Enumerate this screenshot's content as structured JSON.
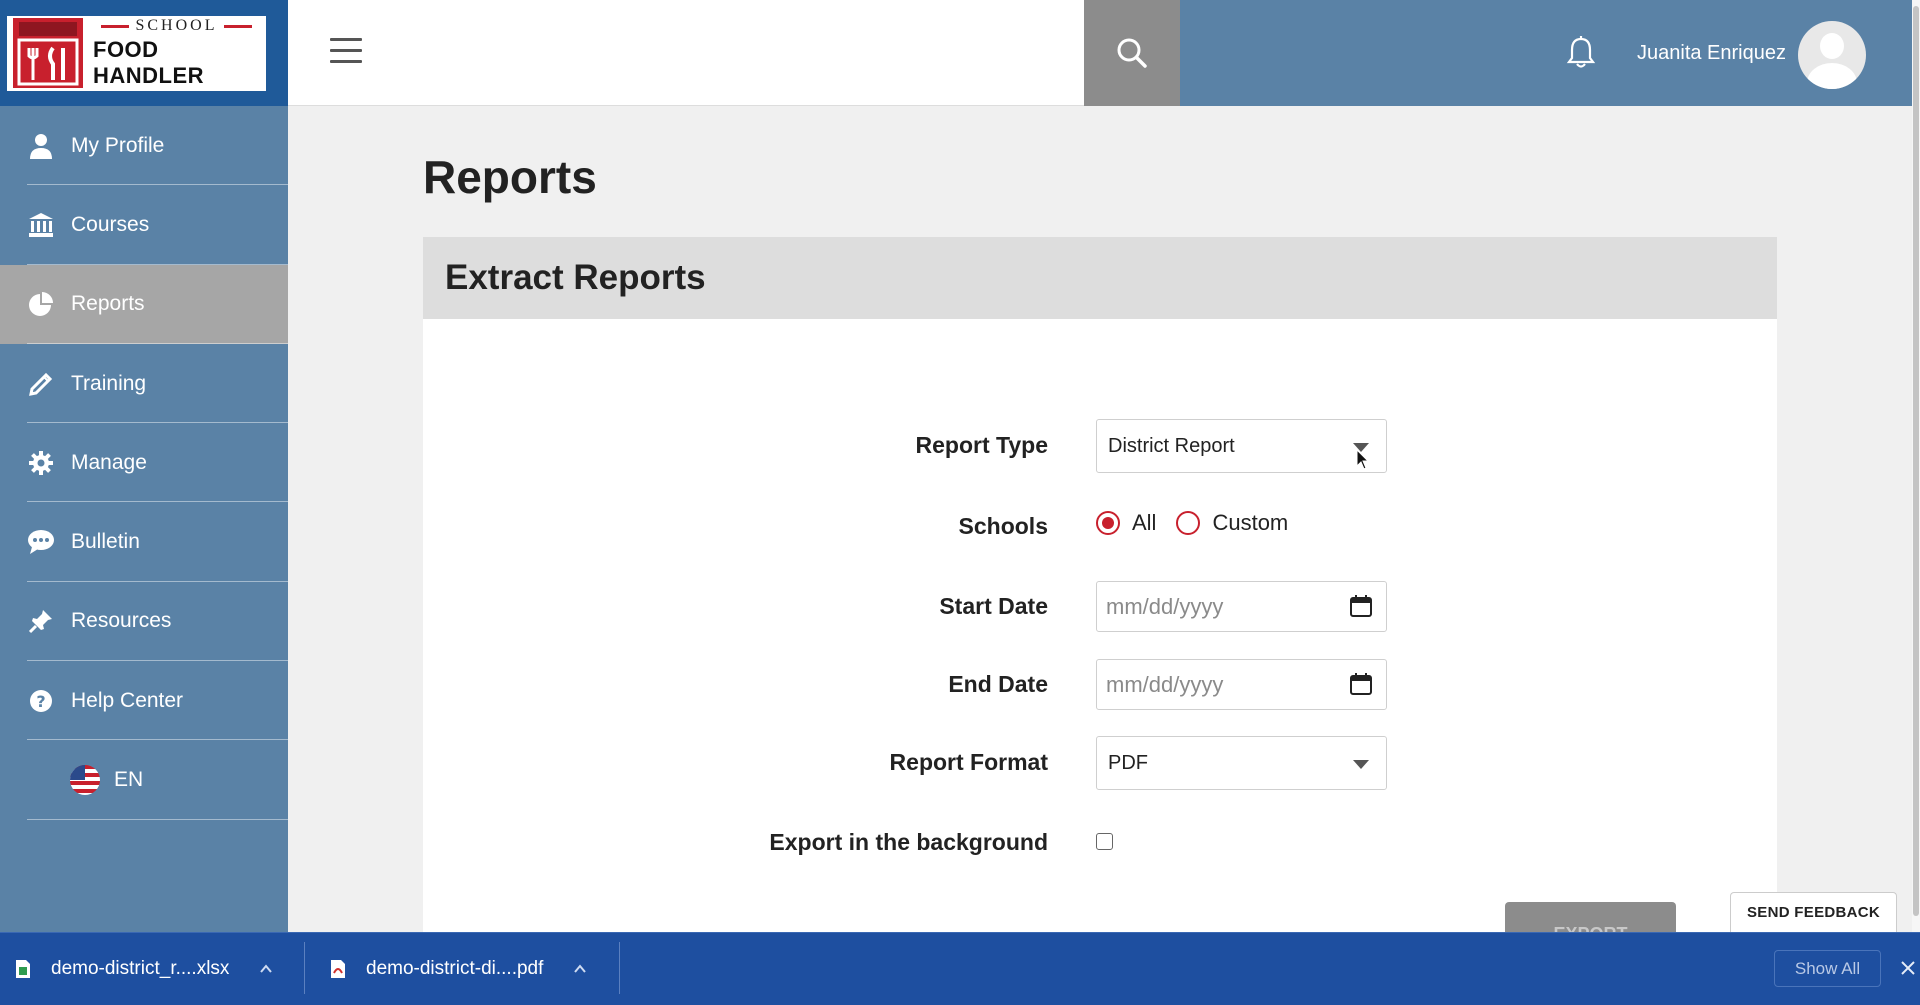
{
  "logo": {
    "line1": "SCHOOL",
    "line2": "FOOD HANDLER"
  },
  "sidebar": {
    "items": [
      {
        "label": "My Profile",
        "icon": "person-icon"
      },
      {
        "label": "Courses",
        "icon": "institution-icon"
      },
      {
        "label": "Reports",
        "icon": "pie-chart-icon",
        "active": true
      },
      {
        "label": "Training",
        "icon": "pencil-icon"
      },
      {
        "label": "Manage",
        "icon": "gear-icon"
      },
      {
        "label": "Bulletin",
        "icon": "speech-bubble-icon"
      },
      {
        "label": "Resources",
        "icon": "pin-icon"
      },
      {
        "label": "Help Center",
        "icon": "question-icon"
      }
    ],
    "language": "EN"
  },
  "header": {
    "user_name": "Juanita Enriquez"
  },
  "main": {
    "title": "Reports",
    "panel_title": "Extract Reports",
    "form": {
      "report_type_label": "Report Type",
      "report_type_value": "District Report",
      "schools_label": "Schools",
      "schools_options": [
        "All",
        "Custom"
      ],
      "schools_selected": "All",
      "start_date_label": "Start Date",
      "start_date_placeholder": "mm/dd/yyyy",
      "end_date_label": "End Date",
      "end_date_placeholder": "mm/dd/yyyy",
      "report_format_label": "Report Format",
      "report_format_value": "PDF",
      "export_bg_label": "Export in the background",
      "export_bg_checked": false
    },
    "export_button": "EXPORT",
    "feedback_button": "SEND FEEDBACK"
  },
  "downloads": {
    "items": [
      {
        "name": "demo-district_r....xlsx",
        "type": "xlsx"
      },
      {
        "name": "demo-district-di....pdf",
        "type": "pdf"
      }
    ],
    "show_all": "Show All"
  },
  "colors": {
    "sidebar": "#5a82a6",
    "logo_bg": "#1f5a99",
    "accent": "#c8202d",
    "download_bar": "#1e4fa0"
  }
}
